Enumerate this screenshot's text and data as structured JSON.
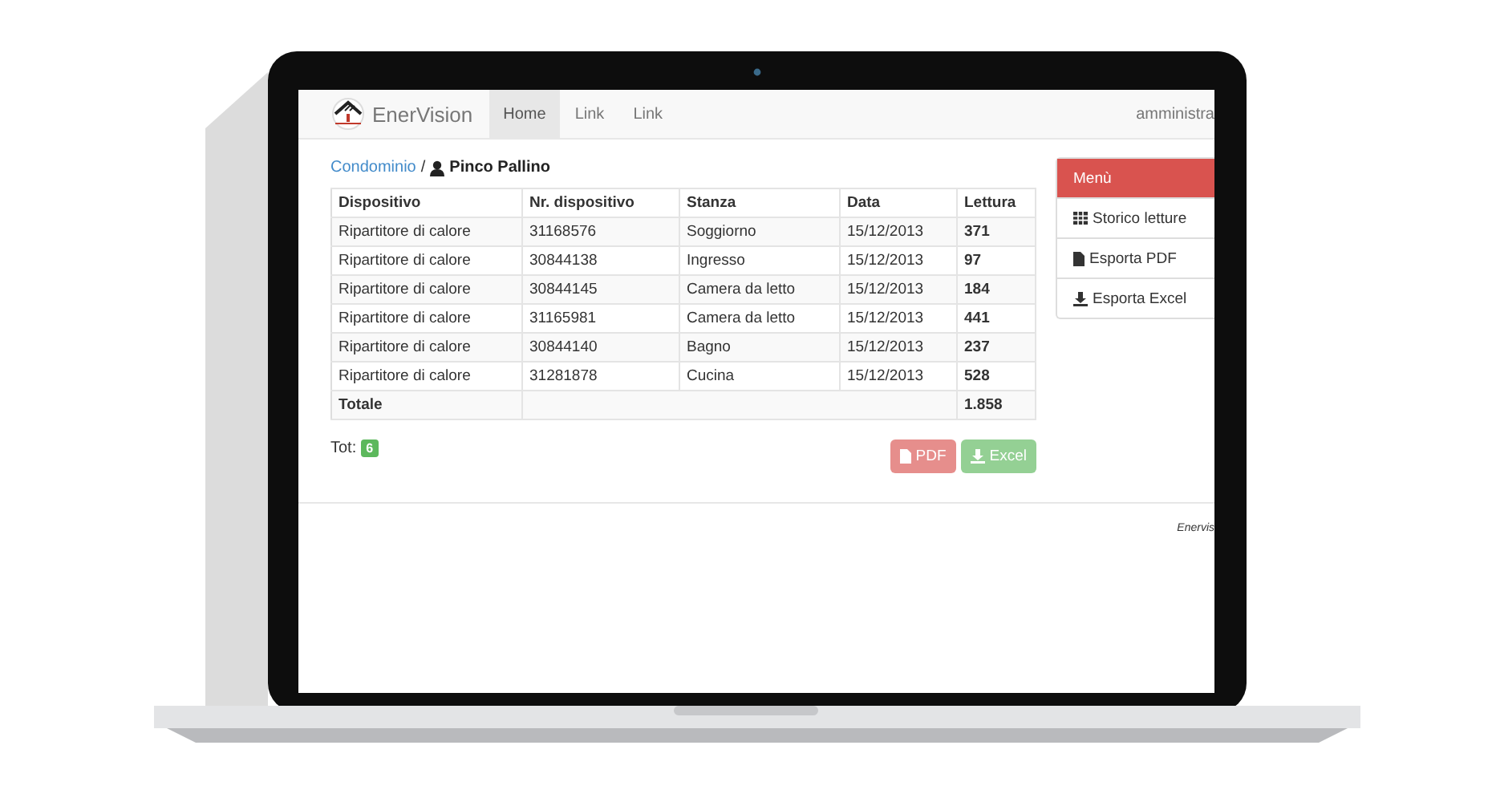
{
  "navbar": {
    "brand": "EnerVision",
    "nav": [
      {
        "label": "Home",
        "selected": true
      },
      {
        "label": "Link",
        "selected": false
      },
      {
        "label": "Link",
        "selected": false
      }
    ],
    "user": "amministra"
  },
  "breadcrumb": {
    "link": "Condominio",
    "separator": "/",
    "current": "Pinco Pallino"
  },
  "table": {
    "columns": [
      "Dispositivo",
      "Nr. dispositivo",
      "Stanza",
      "Data",
      "Lettura"
    ],
    "rows": [
      [
        "Ripartitore di calore",
        "31168576",
        "Soggiorno",
        "15/12/2013",
        "371"
      ],
      [
        "Ripartitore di calore",
        "30844138",
        "Ingresso",
        "15/12/2013",
        "97"
      ],
      [
        "Ripartitore di calore",
        "30844145",
        "Camera da letto",
        "15/12/2013",
        "184"
      ],
      [
        "Ripartitore di calore",
        "31165981",
        "Camera da letto",
        "15/12/2013",
        "441"
      ],
      [
        "Ripartitore di calore",
        "30844140",
        "Bagno",
        "15/12/2013",
        "237"
      ],
      [
        "Ripartitore di calore",
        "31281878",
        "Cucina",
        "15/12/2013",
        "528"
      ]
    ],
    "total": {
      "label": "Totale",
      "value": "1.858"
    }
  },
  "tot": {
    "label": "Tot:",
    "badge": "6"
  },
  "buttons": [
    {
      "label": "PDF",
      "kind": "danger",
      "disabled": true
    },
    {
      "label": "Excel",
      "kind": "success",
      "disabled": true
    }
  ],
  "sidebar": {
    "heading": "Menù",
    "items": [
      "Storico letture",
      "Esporta PDF",
      "Esporta Excel"
    ]
  },
  "footer": "Enervis"
}
